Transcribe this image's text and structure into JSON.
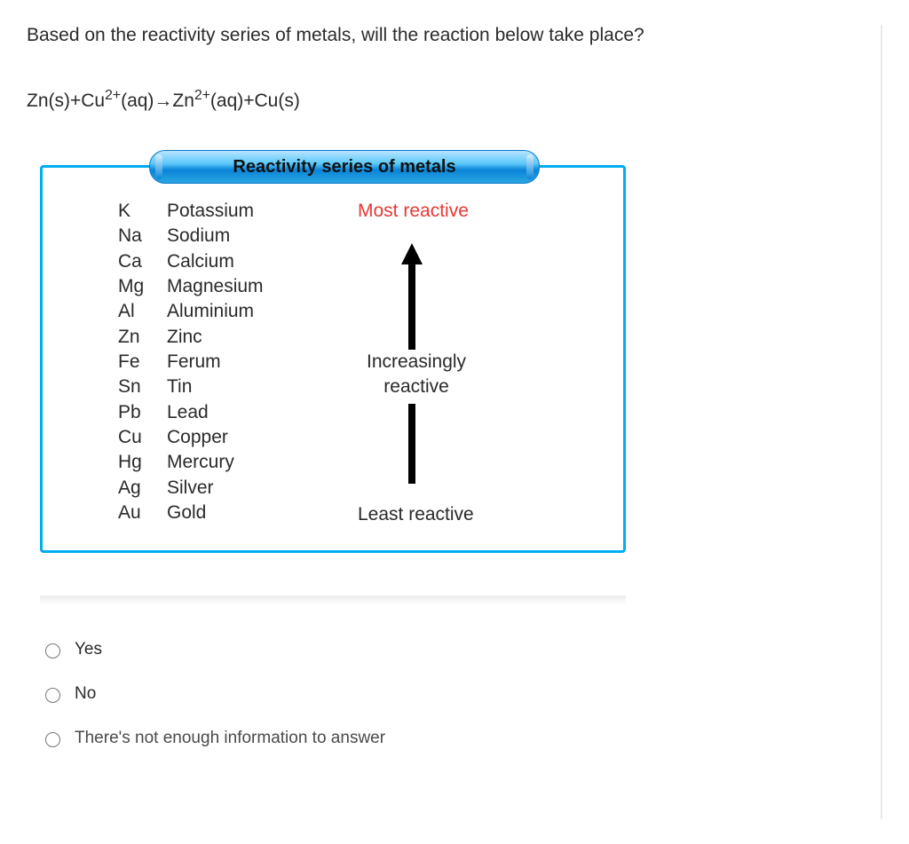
{
  "question": "Based on the reactivity series of metals, will the reaction below take place?",
  "equation_html": "Zn(s)+Cu<sup>2+</sup>(aq)→Zn<sup>2+</sup>(aq)+Cu(s)",
  "panel": {
    "title": "Reactivity series of metals",
    "most": "Most reactive",
    "increasing_line1": "Increasingly",
    "increasing_line2": "reactive",
    "least": "Least reactive",
    "metals": [
      {
        "sym": "K",
        "name": "Potassium"
      },
      {
        "sym": "Na",
        "name": "Sodium"
      },
      {
        "sym": "Ca",
        "name": "Calcium"
      },
      {
        "sym": "Mg",
        "name": "Magnesium"
      },
      {
        "sym": "Al",
        "name": "Aluminium"
      },
      {
        "sym": "Zn",
        "name": "Zinc"
      },
      {
        "sym": "Fe",
        "name": "Ferum"
      },
      {
        "sym": "Sn",
        "name": "Tin"
      },
      {
        "sym": "Pb",
        "name": "Lead"
      },
      {
        "sym": "Cu",
        "name": "Copper"
      },
      {
        "sym": "Hg",
        "name": "Mercury"
      },
      {
        "sym": "Ag",
        "name": "Silver"
      },
      {
        "sym": "Au",
        "name": "Gold"
      }
    ]
  },
  "options": [
    "Yes",
    "No",
    "There's not enough information to answer"
  ]
}
